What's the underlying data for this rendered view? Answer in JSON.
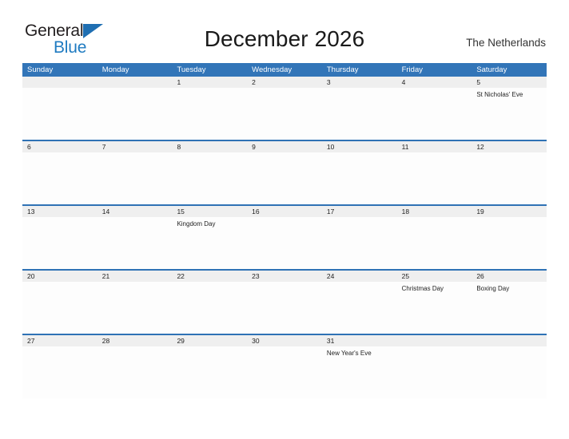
{
  "brand": {
    "name_part1": "General",
    "name_part2": "Blue",
    "triangle_icon": "triangle-icon",
    "color_primary": "#1f7bc1",
    "color_text": "#231f20"
  },
  "header": {
    "title": "December 2026",
    "region": "The Netherlands"
  },
  "calendar": {
    "accent_color": "#3275b8",
    "band_color": "#efefef",
    "weekdays": [
      "Sunday",
      "Monday",
      "Tuesday",
      "Wednesday",
      "Thursday",
      "Friday",
      "Saturday"
    ],
    "weeks": [
      [
        {
          "date": "",
          "events": []
        },
        {
          "date": "",
          "events": []
        },
        {
          "date": "1",
          "events": []
        },
        {
          "date": "2",
          "events": []
        },
        {
          "date": "3",
          "events": []
        },
        {
          "date": "4",
          "events": []
        },
        {
          "date": "5",
          "events": [
            "St Nicholas' Eve"
          ]
        }
      ],
      [
        {
          "date": "6",
          "events": []
        },
        {
          "date": "7",
          "events": []
        },
        {
          "date": "8",
          "events": []
        },
        {
          "date": "9",
          "events": []
        },
        {
          "date": "10",
          "events": []
        },
        {
          "date": "11",
          "events": []
        },
        {
          "date": "12",
          "events": []
        }
      ],
      [
        {
          "date": "13",
          "events": []
        },
        {
          "date": "14",
          "events": []
        },
        {
          "date": "15",
          "events": [
            "Kingdom Day"
          ]
        },
        {
          "date": "16",
          "events": []
        },
        {
          "date": "17",
          "events": []
        },
        {
          "date": "18",
          "events": []
        },
        {
          "date": "19",
          "events": []
        }
      ],
      [
        {
          "date": "20",
          "events": []
        },
        {
          "date": "21",
          "events": []
        },
        {
          "date": "22",
          "events": []
        },
        {
          "date": "23",
          "events": []
        },
        {
          "date": "24",
          "events": []
        },
        {
          "date": "25",
          "events": [
            "Christmas Day"
          ]
        },
        {
          "date": "26",
          "events": [
            "Boxing Day"
          ]
        }
      ],
      [
        {
          "date": "27",
          "events": []
        },
        {
          "date": "28",
          "events": []
        },
        {
          "date": "29",
          "events": []
        },
        {
          "date": "30",
          "events": []
        },
        {
          "date": "31",
          "events": [
            "New Year's Eve"
          ]
        },
        {
          "date": "",
          "events": []
        },
        {
          "date": "",
          "events": []
        }
      ]
    ]
  }
}
